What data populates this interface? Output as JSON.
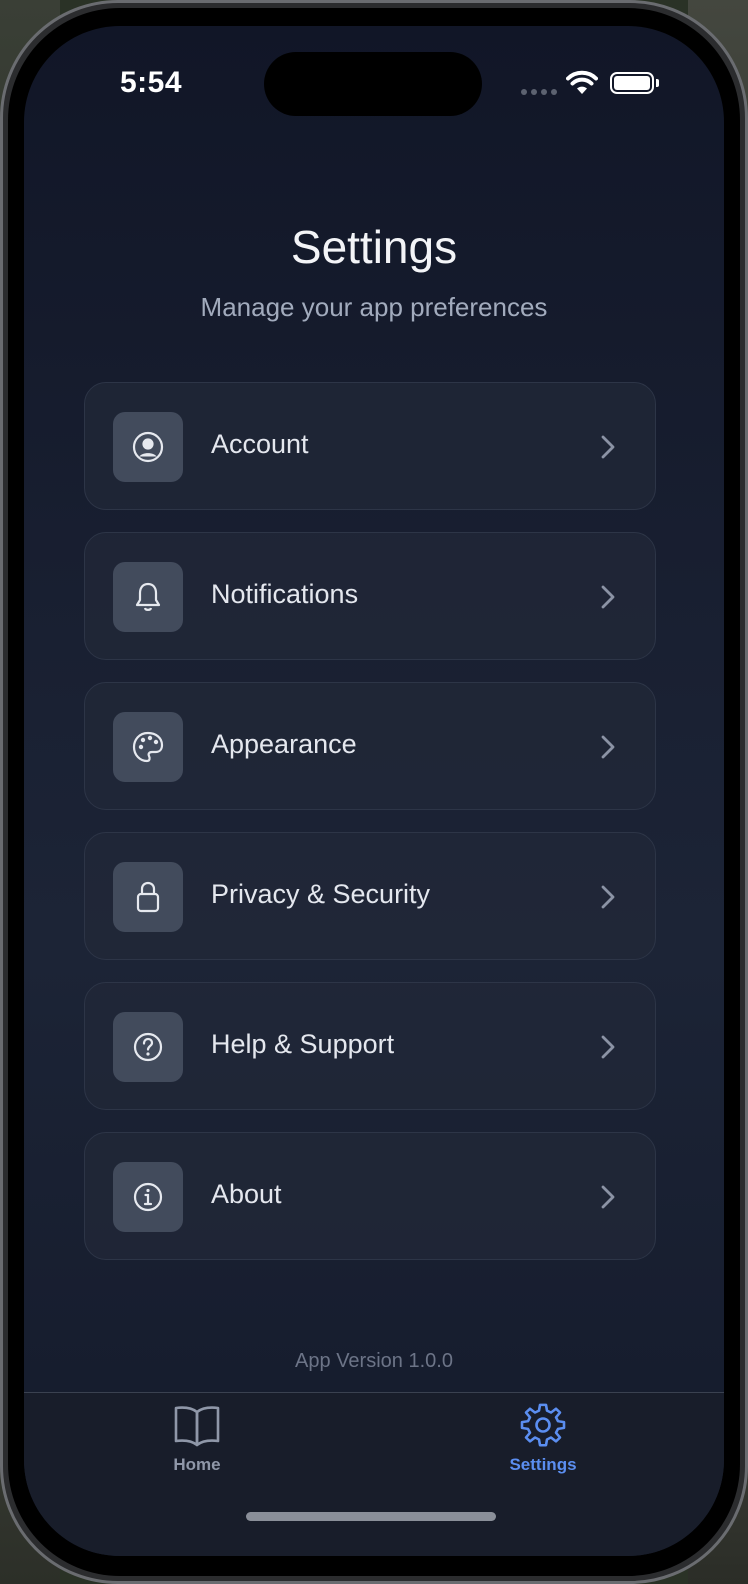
{
  "status_bar": {
    "time": "5:54",
    "wifi_icon": "wifi-icon",
    "battery_icon": "battery-icon"
  },
  "header": {
    "title": "Settings",
    "subtitle": "Manage your app preferences"
  },
  "menu": {
    "items": [
      {
        "label": "Account",
        "icon": "user-circle-icon"
      },
      {
        "label": "Notifications",
        "icon": "bell-icon"
      },
      {
        "label": "Appearance",
        "icon": "palette-icon"
      },
      {
        "label": "Privacy & Security",
        "icon": "lock-icon"
      },
      {
        "label": "Help & Support",
        "icon": "question-circle-icon"
      },
      {
        "label": "About",
        "icon": "info-circle-icon"
      }
    ]
  },
  "footer": {
    "version": "App Version 1.0.0"
  },
  "tab_bar": {
    "tabs": [
      {
        "label": "Home",
        "icon": "book-icon",
        "active": false
      },
      {
        "label": "Settings",
        "icon": "gear-icon",
        "active": true
      }
    ]
  },
  "colors": {
    "accent": "#5b8ef0",
    "background": "#1a2133",
    "card": "#222838",
    "icon_box": "#424b5c"
  }
}
